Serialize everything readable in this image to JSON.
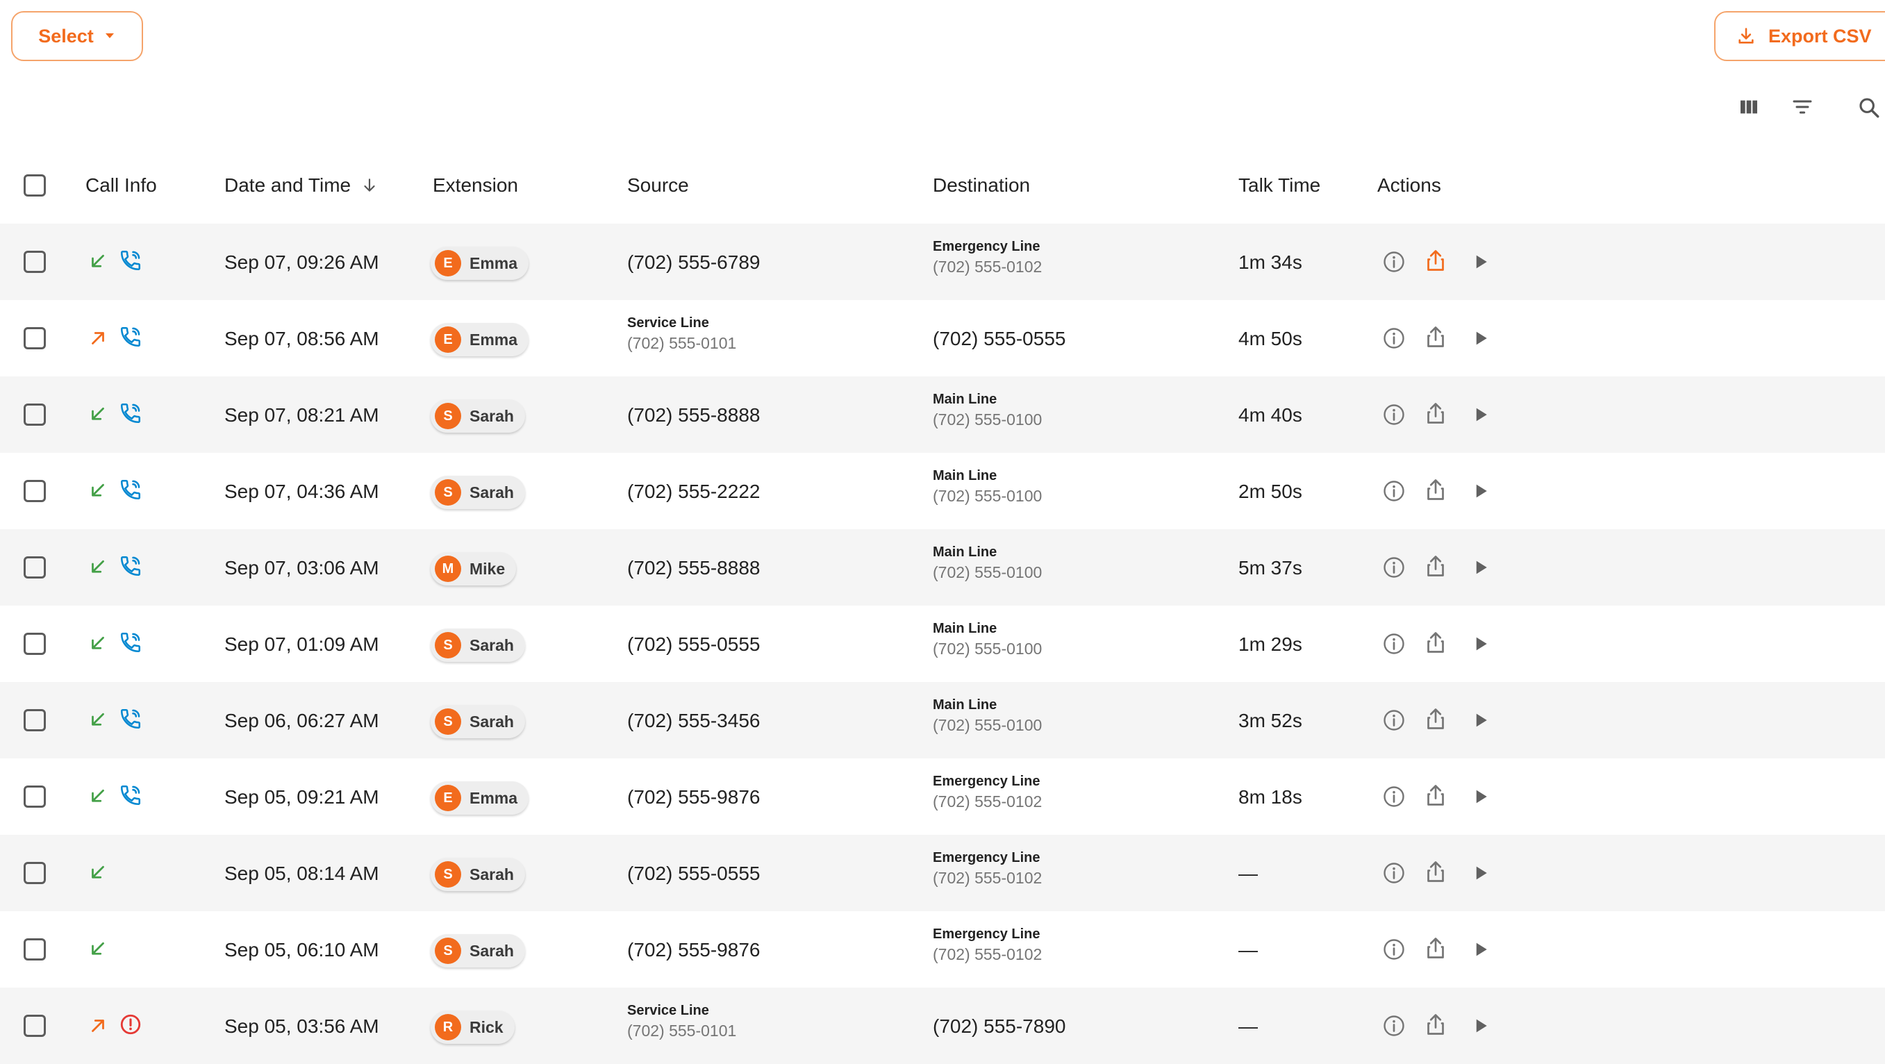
{
  "toolbar": {
    "select_label": "Select",
    "export_label": "Export CSV"
  },
  "table": {
    "headers": {
      "call_info": "Call Info",
      "date_time": "Date and Time",
      "extension": "Extension",
      "source": "Source",
      "destination": "Destination",
      "talk_time": "Talk Time",
      "actions": "Actions"
    },
    "sort": {
      "column": "date_time",
      "direction": "desc"
    },
    "rows": [
      {
        "direction": "incoming",
        "status": "phone-icon",
        "date": "Sep 07, 09:26 AM",
        "ext_initial": "E",
        "ext_name": "Emma",
        "source_label": "",
        "source_number": "(702) 555-6789",
        "dest_label": "Emergency Line",
        "dest_number": "(702) 555-0102",
        "talk": "1m 34s",
        "export_active": true
      },
      {
        "direction": "outgoing",
        "status": "phone-icon",
        "date": "Sep 07, 08:56 AM",
        "ext_initial": "E",
        "ext_name": "Emma",
        "source_label": "Service Line",
        "source_number": "(702) 555-0101",
        "dest_label": "",
        "dest_number": "(702) 555-0555",
        "talk": "4m 50s",
        "export_active": false
      },
      {
        "direction": "incoming",
        "status": "phone-icon",
        "date": "Sep 07, 08:21 AM",
        "ext_initial": "S",
        "ext_name": "Sarah",
        "source_label": "",
        "source_number": "(702) 555-8888",
        "dest_label": "Main Line",
        "dest_number": "(702) 555-0100",
        "talk": "4m 40s",
        "export_active": false
      },
      {
        "direction": "incoming",
        "status": "phone-icon",
        "date": "Sep 07, 04:36 AM",
        "ext_initial": "S",
        "ext_name": "Sarah",
        "source_label": "",
        "source_number": "(702) 555-2222",
        "dest_label": "Main Line",
        "dest_number": "(702) 555-0100",
        "talk": "2m 50s",
        "export_active": false
      },
      {
        "direction": "incoming",
        "status": "phone-icon",
        "date": "Sep 07, 03:06 AM",
        "ext_initial": "M",
        "ext_name": "Mike",
        "source_label": "",
        "source_number": "(702) 555-8888",
        "dest_label": "Main Line",
        "dest_number": "(702) 555-0100",
        "talk": "5m 37s",
        "export_active": false
      },
      {
        "direction": "incoming",
        "status": "phone-icon",
        "date": "Sep 07, 01:09 AM",
        "ext_initial": "S",
        "ext_name": "Sarah",
        "source_label": "",
        "source_number": "(702) 555-0555",
        "dest_label": "Main Line",
        "dest_number": "(702) 555-0100",
        "talk": "1m 29s",
        "export_active": false
      },
      {
        "direction": "incoming",
        "status": "phone-icon",
        "date": "Sep 06, 06:27 AM",
        "ext_initial": "S",
        "ext_name": "Sarah",
        "source_label": "",
        "source_number": "(702) 555-3456",
        "dest_label": "Main Line",
        "dest_number": "(702) 555-0100",
        "talk": "3m 52s",
        "export_active": false
      },
      {
        "direction": "incoming",
        "status": "phone-icon",
        "date": "Sep 05, 09:21 AM",
        "ext_initial": "E",
        "ext_name": "Emma",
        "source_label": "",
        "source_number": "(702) 555-9876",
        "dest_label": "Emergency Line",
        "dest_number": "(702) 555-0102",
        "talk": "8m 18s",
        "export_active": false
      },
      {
        "direction": "incoming",
        "status": "",
        "date": "Sep 05, 08:14 AM",
        "ext_initial": "S",
        "ext_name": "Sarah",
        "source_label": "",
        "source_number": "(702) 555-0555",
        "dest_label": "Emergency Line",
        "dest_number": "(702) 555-0102",
        "talk": "—",
        "export_active": false
      },
      {
        "direction": "incoming",
        "status": "",
        "date": "Sep 05, 06:10 AM",
        "ext_initial": "S",
        "ext_name": "Sarah",
        "source_label": "",
        "source_number": "(702) 555-9876",
        "dest_label": "Emergency Line",
        "dest_number": "(702) 555-0102",
        "talk": "—",
        "export_active": false
      },
      {
        "direction": "outgoing",
        "status": "error-icon",
        "date": "Sep 05, 03:56 AM",
        "ext_initial": "R",
        "ext_name": "Rick",
        "source_label": "Service Line",
        "source_number": "(702) 555-0101",
        "dest_label": "",
        "dest_number": "(702) 555-7890",
        "talk": "—",
        "export_active": false
      }
    ]
  },
  "colors": {
    "accent": "#f26b1d",
    "incoming": "#43a047",
    "outgoing": "#f26b1d",
    "phone": "#0288d1",
    "error": "#e53935",
    "row_alt": "#f5f5f5"
  }
}
